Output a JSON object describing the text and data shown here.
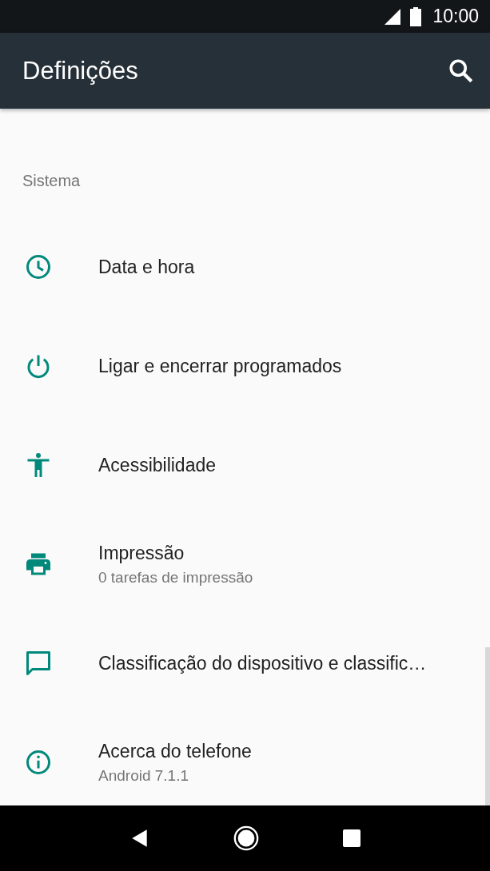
{
  "status_bar": {
    "time": "10:00"
  },
  "app_bar": {
    "title": "Definições"
  },
  "section": {
    "title": "Sistema"
  },
  "items": [
    {
      "kind": "clock",
      "title": "Data e hora"
    },
    {
      "kind": "power",
      "title": "Ligar e encerrar programados"
    },
    {
      "kind": "accessibility",
      "title": "Acessibilidade"
    },
    {
      "kind": "printer",
      "title": "Impressão",
      "summary": "0 tarefas de impressão"
    },
    {
      "kind": "message",
      "title": "Classificação do dispositivo e classific…"
    },
    {
      "kind": "info",
      "title": "Acerca do telefone",
      "summary": "Android 7.1.1"
    }
  ]
}
